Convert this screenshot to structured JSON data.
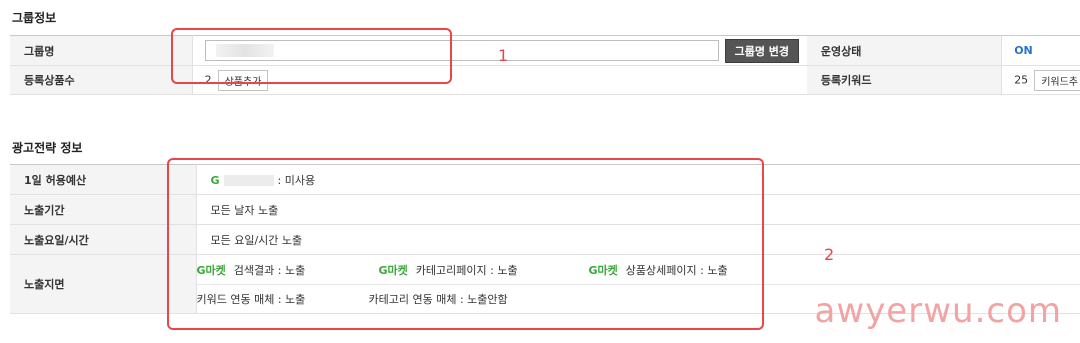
{
  "group_section": {
    "title": "그룹정보",
    "group_name_label": "그룹명",
    "group_name_value": "",
    "change_name_button": "그룹명 변경",
    "status_label": "운영상태",
    "status_value": "ON",
    "registered_products_label": "등록상품수",
    "registered_products_count": "2",
    "add_product_button": "상품추가",
    "registered_keywords_label": "등록키워드",
    "registered_keywords_count": "25",
    "keyword_button": "키워드추"
  },
  "strategy_section": {
    "title": "광고전략 정보",
    "budget_label": "1일 허용예산",
    "budget_g": "G",
    "budget_value": ": 미사용",
    "period_label": "노출기간",
    "period_value": "모든 날자 노출",
    "weekday_label": "노출요일/시간",
    "weekday_value": "모든 요일/시간 노출",
    "placement_label": "노출지면",
    "channels": [
      {
        "brand": "G마켓",
        "text": "검색결과 : 노출"
      },
      {
        "brand": "G마켓",
        "text": "카테고리페이지 : 노출"
      },
      {
        "brand": "G마켓",
        "text": "상품상세페이지 : 노출"
      }
    ],
    "partner_channels": [
      {
        "text": "키워드 연동 매체 : 노출"
      },
      {
        "text": "카테고리 연동 매체 : 노출안함"
      }
    ]
  },
  "annotations": {
    "box1_number": "1",
    "box2_number": "2",
    "watermark": "awyerwu.com"
  }
}
